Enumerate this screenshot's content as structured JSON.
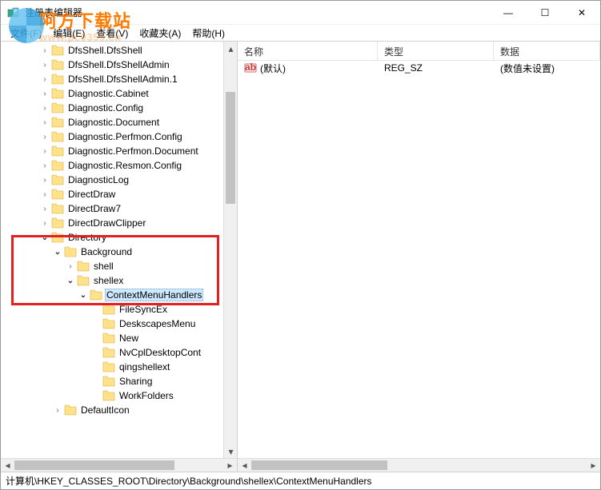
{
  "window": {
    "title": "注册表编辑器",
    "minimize": "—",
    "maximize": "☐",
    "close": "✕"
  },
  "watermark": {
    "cn": "阿方下载站",
    "url": "www.pc0359.cn"
  },
  "menu": {
    "file": "文件(F)",
    "edit": "编辑(E)",
    "view": "查看(V)",
    "favorites": "收藏夹(A)",
    "help": "帮助(H)"
  },
  "tree": {
    "items": [
      {
        "level": 3,
        "exp": "closed",
        "label": "DfsShell.DfsShell"
      },
      {
        "level": 3,
        "exp": "closed",
        "label": "DfsShell.DfsShellAdmin"
      },
      {
        "level": 3,
        "exp": "closed",
        "label": "DfsShell.DfsShellAdmin.1"
      },
      {
        "level": 3,
        "exp": "closed",
        "label": "Diagnostic.Cabinet"
      },
      {
        "level": 3,
        "exp": "closed",
        "label": "Diagnostic.Config"
      },
      {
        "level": 3,
        "exp": "closed",
        "label": "Diagnostic.Document"
      },
      {
        "level": 3,
        "exp": "closed",
        "label": "Diagnostic.Perfmon.Config"
      },
      {
        "level": 3,
        "exp": "closed",
        "label": "Diagnostic.Perfmon.Document"
      },
      {
        "level": 3,
        "exp": "closed",
        "label": "Diagnostic.Resmon.Config"
      },
      {
        "level": 3,
        "exp": "closed",
        "label": "DiagnosticLog"
      },
      {
        "level": 3,
        "exp": "closed",
        "label": "DirectDraw"
      },
      {
        "level": 3,
        "exp": "closed",
        "label": "DirectDraw7"
      },
      {
        "level": 3,
        "exp": "closed",
        "label": "DirectDrawClipper"
      },
      {
        "level": 3,
        "exp": "open",
        "label": "Directory"
      },
      {
        "level": 4,
        "exp": "open",
        "label": "Background"
      },
      {
        "level": 5,
        "exp": "closed",
        "label": "shell"
      },
      {
        "level": 5,
        "exp": "open",
        "label": "shellex"
      },
      {
        "level": 6,
        "exp": "open",
        "label": "ContextMenuHandlers",
        "selected": true
      },
      {
        "level": 7,
        "exp": "none",
        "label": "FileSyncEx"
      },
      {
        "level": 7,
        "exp": "none",
        "label": "DeskscapesMenu"
      },
      {
        "level": 7,
        "exp": "none",
        "label": "New"
      },
      {
        "level": 7,
        "exp": "none",
        "label": "NvCplDesktopCont"
      },
      {
        "level": 7,
        "exp": "none",
        "label": "qingshellext"
      },
      {
        "level": 7,
        "exp": "none",
        "label": "Sharing"
      },
      {
        "level": 7,
        "exp": "none",
        "label": "WorkFolders"
      },
      {
        "level": 4,
        "exp": "closed",
        "label": "DefaultIcon"
      }
    ]
  },
  "list": {
    "columns": {
      "name": "名称",
      "type": "类型",
      "data": "数据"
    },
    "rows": [
      {
        "name": "(默认)",
        "type": "REG_SZ",
        "data": "(数值未设置)"
      }
    ]
  },
  "status": {
    "path": "计算机\\HKEY_CLASSES_ROOT\\Directory\\Background\\shellex\\ContextMenuHandlers"
  },
  "colwidths": {
    "name": 175,
    "type": 145,
    "data": 200
  }
}
